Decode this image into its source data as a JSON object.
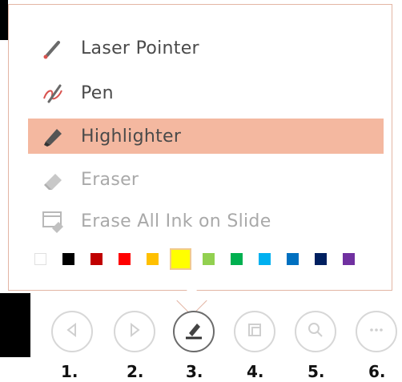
{
  "menu": {
    "items": [
      {
        "label": "Laser Pointer",
        "icon": "laser-pointer-icon",
        "state": "normal"
      },
      {
        "label": "Pen",
        "icon": "pen-icon",
        "state": "normal"
      },
      {
        "label": "Highlighter",
        "icon": "highlighter-icon",
        "state": "selected"
      },
      {
        "label": "Eraser",
        "icon": "eraser-icon",
        "state": "disabled"
      },
      {
        "label": "Erase All Ink on Slide",
        "icon": "erase-all-ink-icon",
        "state": "disabled"
      }
    ]
  },
  "colors": {
    "swatches": [
      "#ffffff",
      "#000000",
      "#c00000",
      "#ff0000",
      "#ffc000",
      "#ffff00",
      "#92d050",
      "#00b050",
      "#00b0f0",
      "#0070c0",
      "#002060",
      "#7030a0"
    ],
    "selected": "#ffff00",
    "highlight_bg": "#f4b8a0",
    "popup_border": "#e3b5a4"
  },
  "toolbar": {
    "buttons": [
      {
        "icon": "previous-icon",
        "label": "1."
      },
      {
        "icon": "next-icon",
        "label": "2."
      },
      {
        "icon": "pen-tool-icon",
        "label": "3.",
        "active": true
      },
      {
        "icon": "see-all-slides-icon",
        "label": "4."
      },
      {
        "icon": "zoom-icon",
        "label": "5."
      },
      {
        "icon": "more-options-icon",
        "label": "6."
      }
    ]
  }
}
